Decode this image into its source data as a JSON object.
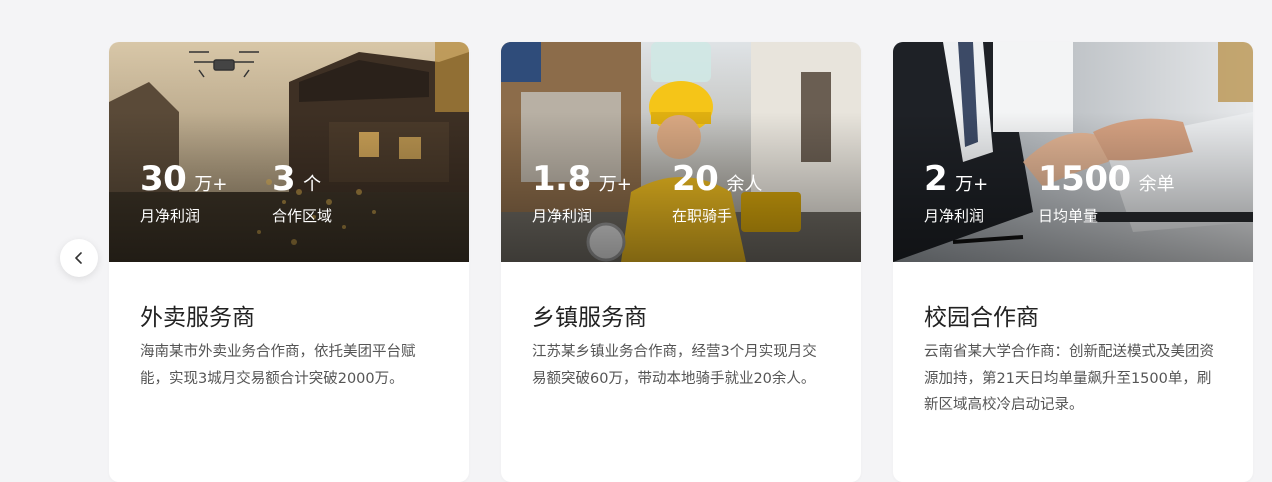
{
  "nav": {
    "prev_icon": "chevron-left-icon"
  },
  "cards": [
    {
      "stats": [
        {
          "value": "30",
          "unit": "万+",
          "label": "月净利润"
        },
        {
          "value": "3",
          "unit": "个",
          "label": "合作区域"
        }
      ],
      "title": "外卖服务商",
      "description": "海南某市外卖业务合作商，依托美团平台赋能，实现3城月交易额合计突破2000万。"
    },
    {
      "stats": [
        {
          "value": "1.8",
          "unit": "万+",
          "label": "月净利润"
        },
        {
          "value": "20",
          "unit": "余人",
          "label": "在职骑手"
        }
      ],
      "title": "乡镇服务商",
      "description": "江苏某乡镇业务合作商，经营3个月实现月交易额突破60万，带动本地骑手就业20余人。"
    },
    {
      "stats": [
        {
          "value": "2",
          "unit": "万+",
          "label": "月净利润"
        },
        {
          "value": "1500",
          "unit": "余单",
          "label": "日均单量"
        }
      ],
      "title": "校园合作商",
      "description": "云南省某大学合作商：创新配送模式及美团资源加持，第21天日均单量飙升至1500单，刷新区域高校冷启动记录。"
    }
  ],
  "theme": {
    "accent_yellow": "#f5c518",
    "text_dark": "#222222",
    "text_body": "#555555"
  }
}
